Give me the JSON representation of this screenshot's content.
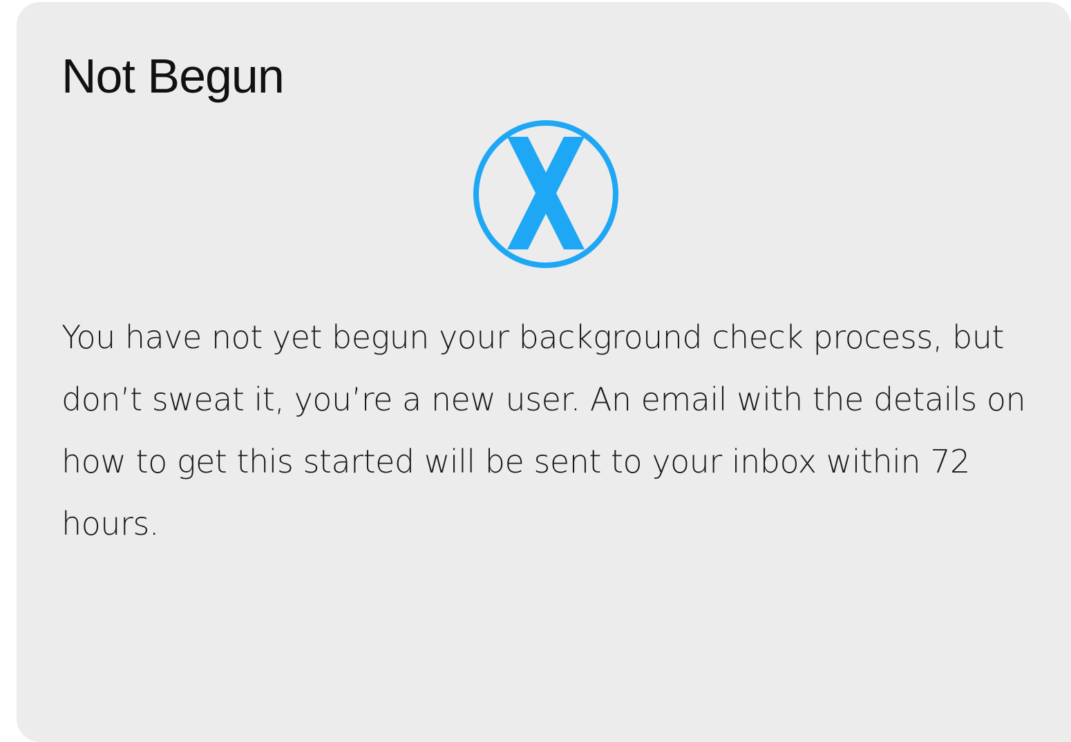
{
  "card": {
    "title": "Not Begun",
    "status_icon": "x-circle-icon",
    "message": "You have not yet begun your background check process, but don’t sweat it, you’re a new user. An email with the details on how to get this started will be sent to your inbox within 72 hours."
  },
  "colors": {
    "card_background": "#ececed",
    "accent": "#1ea7f5",
    "title_text": "#111111",
    "body_text": "#1a1a1a"
  }
}
